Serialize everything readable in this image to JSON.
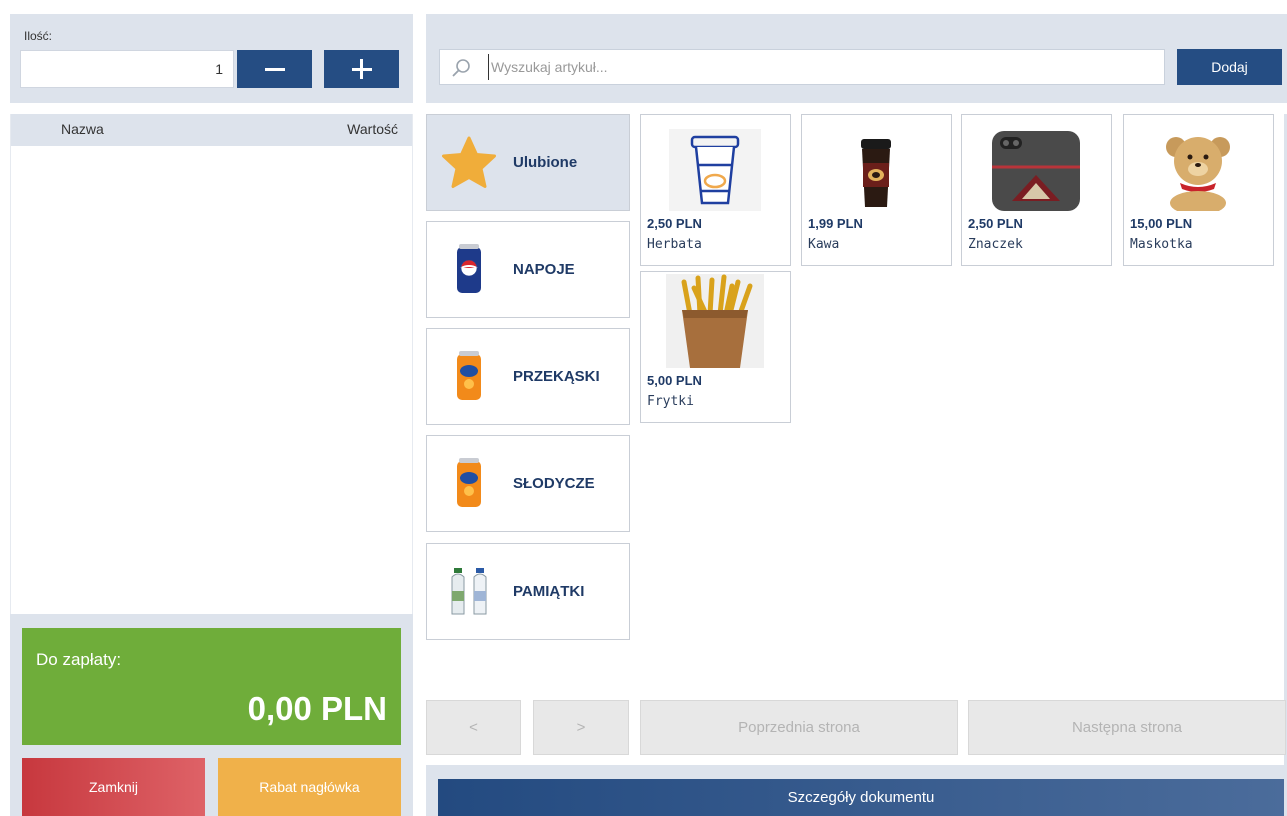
{
  "quantity": {
    "label": "Ilość:",
    "value": "1",
    "minus_icon": "minus-icon",
    "plus_icon": "plus-icon"
  },
  "document_list": {
    "columns": [
      "Nazwa",
      "Wartość"
    ],
    "rows": []
  },
  "summary": {
    "to_pay_label": "Do zapłaty:",
    "to_pay_amount": "0,00 PLN",
    "close_label": "Zamknij",
    "discount_label": "Rabat nagłówka"
  },
  "search": {
    "placeholder": "Wyszukaj artykuł...",
    "value": "",
    "add_label": "Dodaj"
  },
  "categories": [
    {
      "label": "Ulubione",
      "icon": "star-icon",
      "selected": true
    },
    {
      "label": "NAPOJE",
      "icon": "soda-can-icon",
      "selected": false
    },
    {
      "label": "PRZEKĄSKI",
      "icon": "orange-can-icon",
      "selected": false
    },
    {
      "label": "SŁODYCZE",
      "icon": "orange-can-icon",
      "selected": false
    },
    {
      "label": "PAMIĄTKI",
      "icon": "water-bottles-icon",
      "selected": false
    }
  ],
  "products": [
    {
      "price": "2,50 PLN",
      "name": "Herbata",
      "icon": "paper-cup-icon"
    },
    {
      "price": "1,99 PLN",
      "name": "Kawa",
      "icon": "coffee-cup-icon"
    },
    {
      "price": "2,50 PLN",
      "name": "Znaczek",
      "icon": "phone-case-icon"
    },
    {
      "price": "15,00 PLN",
      "name": "Maskotka",
      "icon": "teddy-bear-icon"
    },
    {
      "price": "5,00 PLN",
      "name": "Frytki",
      "icon": "fries-icon"
    }
  ],
  "pagination": {
    "prev_label": "<",
    "next_label": ">",
    "prev_page_label": "Poprzednia strona",
    "next_page_label": "Następna strona"
  },
  "footer": {
    "details_label": "Szczegóły dokumentu"
  },
  "colors": {
    "primary": "#254d83",
    "pay_green": "#6fad3a",
    "close_red": "#c7383e",
    "discount_orange": "#f0b14a",
    "panel_bg": "#dde3ec"
  }
}
